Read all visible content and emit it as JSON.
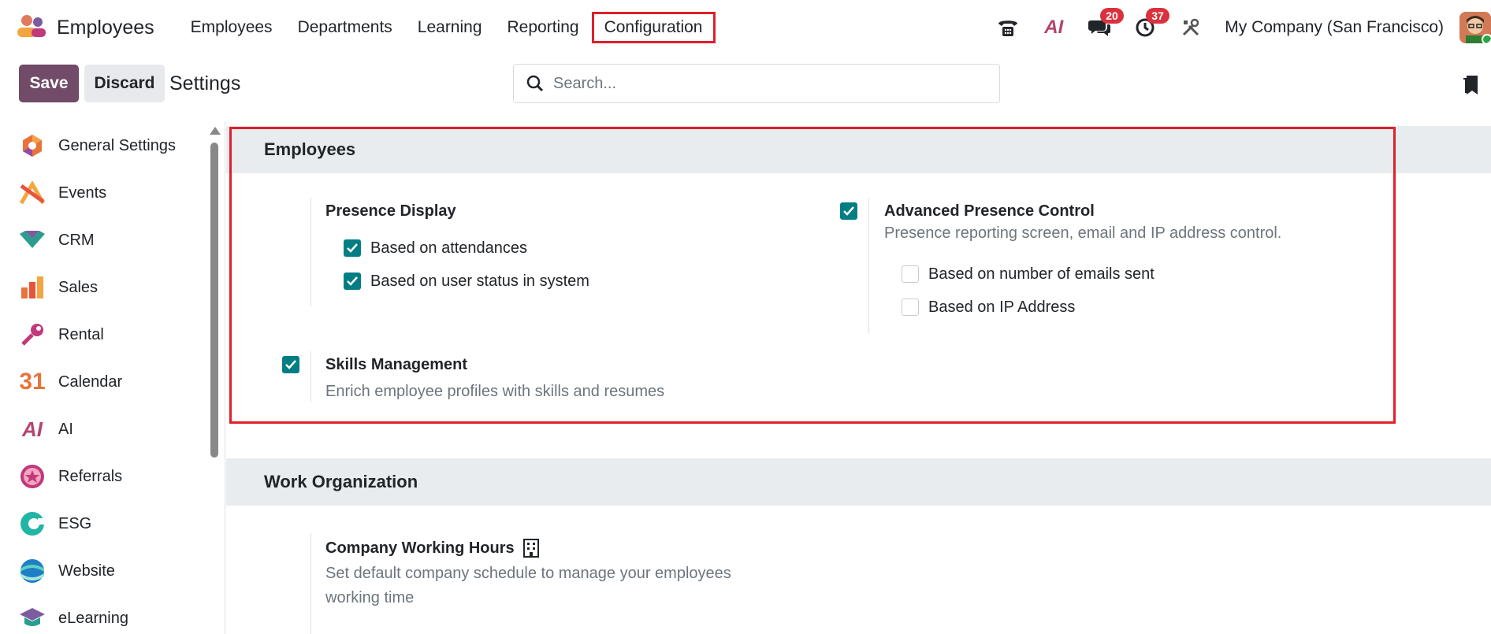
{
  "app": {
    "name": "Employees"
  },
  "nav": [
    {
      "label": "Employees"
    },
    {
      "label": "Departments"
    },
    {
      "label": "Learning"
    },
    {
      "label": "Reporting"
    },
    {
      "label": "Configuration"
    }
  ],
  "topright": {
    "messages_badge": "20",
    "activities_badge": "37",
    "company": "My Company (San Francisco)",
    "ai_label": "AI"
  },
  "controlbar": {
    "save_label": "Save",
    "discard_label": "Discard",
    "title": "Settings",
    "search_placeholder": "Search..."
  },
  "sidebar": {
    "items": [
      {
        "label": "General Settings",
        "icon": "general-settings-icon"
      },
      {
        "label": "Events",
        "icon": "events-icon"
      },
      {
        "label": "CRM",
        "icon": "crm-icon"
      },
      {
        "label": "Sales",
        "icon": "sales-icon"
      },
      {
        "label": "Rental",
        "icon": "rental-icon"
      },
      {
        "label": "Calendar",
        "icon": "calendar-icon",
        "icon_text": "31"
      },
      {
        "label": "AI",
        "icon": "ai-icon",
        "icon_text": "AI"
      },
      {
        "label": "Referrals",
        "icon": "referrals-icon"
      },
      {
        "label": "ESG",
        "icon": "esg-icon"
      },
      {
        "label": "Website",
        "icon": "website-icon"
      },
      {
        "label": "eLearning",
        "icon": "elearning-icon"
      }
    ]
  },
  "sections": {
    "employees": {
      "title": "Employees",
      "presence_display": {
        "title": "Presence Display",
        "options": [
          {
            "label": "Based on attendances",
            "checked": true
          },
          {
            "label": "Based on user status in system",
            "checked": true
          }
        ]
      },
      "advanced_presence": {
        "title": "Advanced Presence Control",
        "checked": true,
        "description": "Presence reporting screen, email and IP address control.",
        "options": [
          {
            "label": "Based on number of emails sent",
            "checked": false
          },
          {
            "label": "Based on IP Address",
            "checked": false
          }
        ]
      },
      "skills": {
        "title": "Skills Management",
        "checked": true,
        "description": "Enrich employee profiles with skills and resumes"
      }
    },
    "work_organization": {
      "title": "Work Organization",
      "working_hours": {
        "title": "Company Working Hours",
        "description_line1": "Set default company schedule to manage your employees",
        "description_line2": "working time"
      }
    }
  },
  "colors": {
    "primary": "#714b67",
    "checkbox": "#017e84",
    "highlight": "#e01f2a",
    "badge": "#d9323e"
  }
}
